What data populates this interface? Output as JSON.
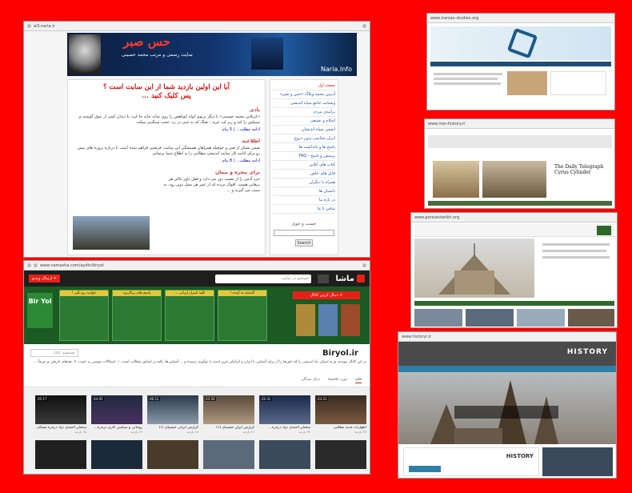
{
  "shot1": {
    "url": "w3.naria.ir",
    "banner_title": "حس صبر",
    "banner_subtitle": "سایت رسمی و مرتب محمد حسینی",
    "banner_logo": "Naria.Info",
    "question_line1": "آیا این اولین بازدید شما از این سایت است ؟",
    "question_line2": "پس کلیک کنید ...",
    "post1_title": "یادی",
    "post1_text": "«کریلایی محمد حسینی» با دیگر برنوی لوله کوتاهش را روی شانه جابه جا کرد، با دندان کمی از عوق گوشته ی سبیلش را کند و زیر لب غرید : تفنگ که به جنی در زد، عجب سنگینی میکنه.",
    "post1_more": "ادامه مطلب... | 5 پیام",
    "post2_title": "اطلاعیه",
    "post2_text": "ضمن تشکر از صبر و حوصله همراهان همیشگی این سایت، فرصتی فراهم شده است تا درباره پروژه های پیش رو برای ادامه کار سایت اندیشی مطالبی را به اطلاع شما برسانم.",
    "post2_more": "ادامه مطلب... | 8 پیام",
    "post3_title": "برای پنجره و بیمان",
    "post3_text": "خرد آدمی را از نصیب دور می دارد و قفل ذاور غالی هر برهانی هست. اقوال مرده که از عمر هر نسل دوبر رود، به سبب می گیرند و ...",
    "side_items": [
      "صفحه اول",
      "آدرس محمد وبلاگ «حس و صبر»",
      "وبسایت جامع سیاه اندیشی",
      "برآمدی مردم",
      "اسلام و تشیعی",
      "انجمن سیاه اندیشان",
      "ایران شناسی بدون دروغ",
      "پاسخ ها و یادداشت ها",
      "پرسش و پاسخ - FAQ",
      "کتاب های آنلاین",
      "فایل های خاص",
      "همراه با دیگران",
      "داستان ها",
      "در باره ما",
      "تماس با ما"
    ],
    "search_title": "جست و جوی",
    "search_button": "Search"
  },
  "shot2": {
    "url": "www.namasha.com/aydin/biryol",
    "logo_text": "ماشا",
    "search_placeholder": "جستجو در سایت",
    "upload_label": "+ ارسال ویدیو",
    "cover_brand": "Bir Yol",
    "cover_red_banner": "+ دنبال کردن کانال",
    "cover_panels": [
      "جوابت رو بگیر !",
      "پاسخ های پرکاربرد",
      "کلید اسرار ایرانی ...",
      "گذشته به آینده !"
    ],
    "channel_name": "Biryol.ir",
    "channel_search": "جستجوی کانال",
    "channel_desc": "در این کانال پیوندی نو به اسکی یاد اندیشی را که ذهن‌ها را از برای آشنایی با ایران و ایرانیان عزیز است با نوآوری رسیده و ... آشنایی‌ها، تکیه بر اساس مطالب است. ۱. اشکالات موسی رد است. ۲. نقدهای تاریخی و صرفاً ...",
    "tabs": [
      "خانه",
      "مورد علاقه‌ها",
      "دنبال شدگان"
    ],
    "videos": [
      {
        "title": "اظهارات جدید مطالبی",
        "views": "۳۷ بازدید",
        "dur": "03:23"
      },
      {
        "title": "سخنان احمدی نژاد درباره...",
        "views": "۳۴ بازدید",
        "dur": "02:41"
      },
      {
        "title": "گزارش ایران جسیبای (۱)",
        "views": "۲۱ بازدید",
        "dur": "03:50"
      },
      {
        "title": "گزارش ایرانی جسیبای (۱)",
        "views": "۱۸ بازدید",
        "dur": "06:12"
      },
      {
        "title": "روحانی و سیاسی کاری درباره...",
        "views": "۲۹ بازدید",
        "dur": "04:05"
      },
      {
        "title": "سخنان احمدی نژاد درباره مسائل...",
        "views": "۲۵ بازدید",
        "dur": "05:17"
      }
    ]
  },
  "thumbs": {
    "r1_url": "www.iranian-studies.org",
    "r2_url": "www.iran-history.ir",
    "r2_caption": "The Daily Telegraph Cyrus Cylinder",
    "r3_url": "www.persiantarikh.org",
    "r4_url": "www.historyi.ir",
    "r4_brand": "HISTORY",
    "r4_heading": "HISTORY"
  },
  "colors": {
    "background": "#ff0000",
    "accent_red": "#e62117",
    "cover_green": "#1b5a23"
  }
}
